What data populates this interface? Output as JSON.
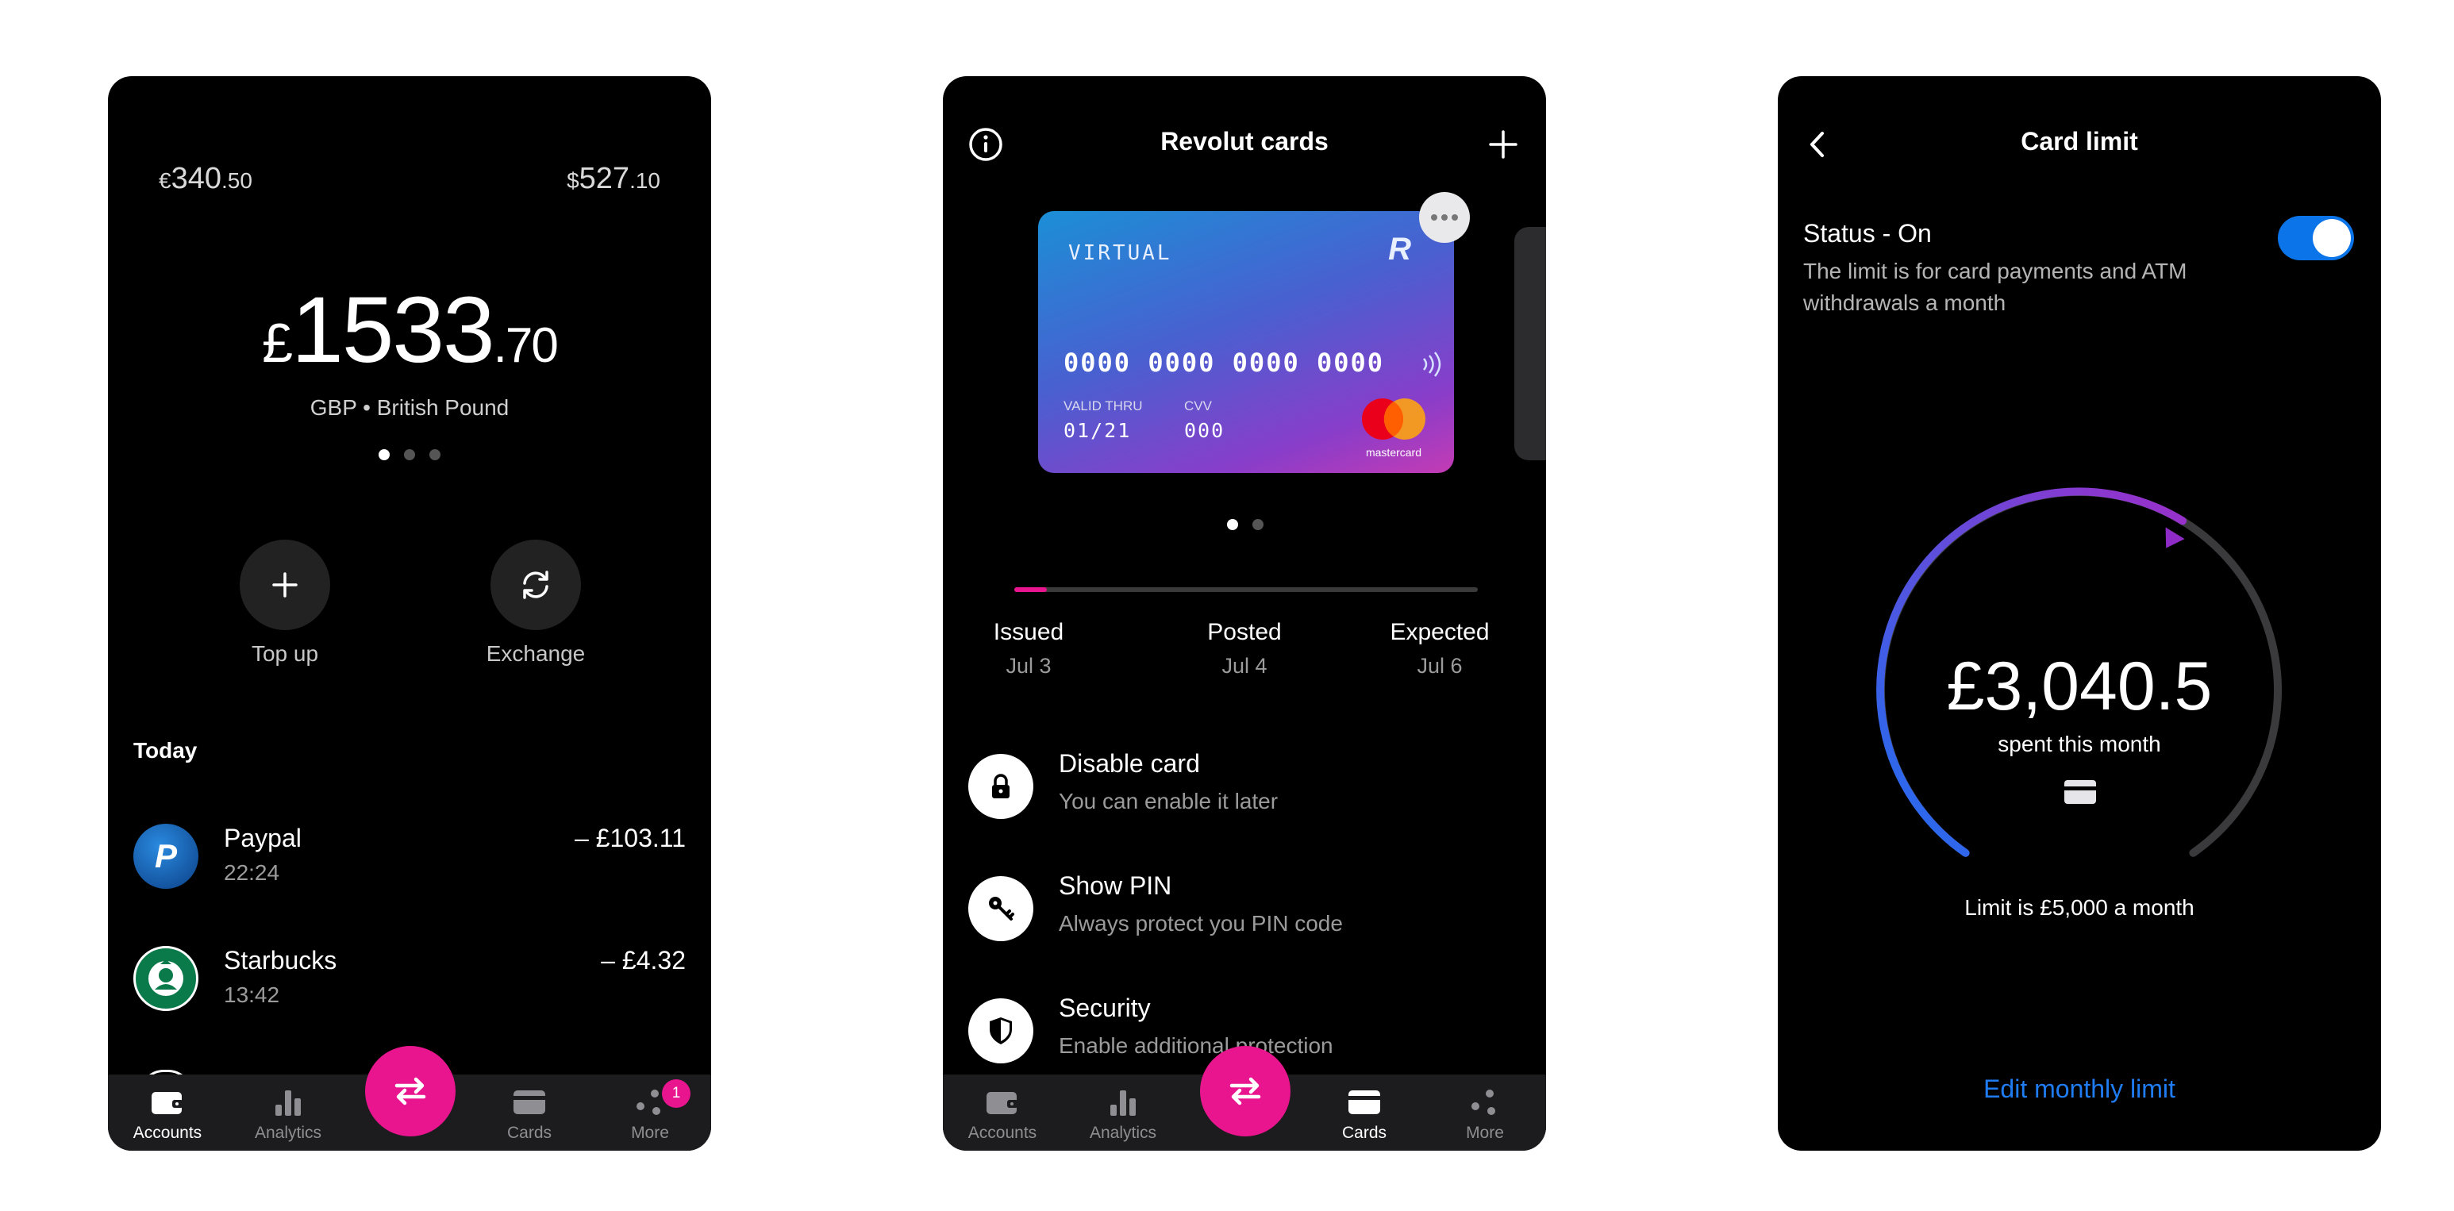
{
  "accounts": {
    "eur_balance": {
      "symbol": "€",
      "whole": "340",
      "decimal": ".50"
    },
    "usd_balance": {
      "symbol": "$",
      "whole": "527",
      "decimal": ".10"
    },
    "main_balance": {
      "symbol": "£",
      "whole": "1533",
      "decimal": ".70"
    },
    "currency_label": "GBP • British Pound",
    "page_dots": {
      "count": 3,
      "active": 0
    },
    "actions": [
      {
        "label": "Top up",
        "icon": "plus-icon"
      },
      {
        "label": "Exchange",
        "icon": "exchange-icon"
      }
    ],
    "section_today": "Today",
    "transactions": [
      {
        "name": "Paypal",
        "time": "22:24",
        "amount": "– £103.11",
        "logo": "paypal-logo-icon"
      },
      {
        "name": "Starbucks",
        "time": "13:42",
        "amount": "– £4.32",
        "logo": "starbucks-logo-icon"
      }
    ]
  },
  "cards": {
    "title": "Revolut cards",
    "info_icon": "info-icon",
    "add_icon": "plus-icon",
    "card": {
      "type": "VIRTUAL",
      "brand_mark": "R",
      "number": "0000 0000 0000 0000",
      "valid_label": "VALID THRU",
      "valid_value": "01/21",
      "cvv_label": "CVV",
      "cvv_value": "000",
      "network": "mastercard"
    },
    "page_dots": {
      "count": 2,
      "active": 0
    },
    "delivery_progress": 0.07,
    "steps": [
      {
        "title": "Issued",
        "date": "Jul 3"
      },
      {
        "title": "Posted",
        "date": "Jul 4"
      },
      {
        "title": "Expected",
        "date": "Jul 6"
      }
    ],
    "options": [
      {
        "title": "Disable card",
        "subtitle": "You can enable it later",
        "icon": "lock-icon"
      },
      {
        "title": "Show PIN",
        "subtitle": "Always protect you PIN code",
        "icon": "key-icon"
      },
      {
        "title": "Security",
        "subtitle": "Enable additional protection",
        "icon": "shield-icon"
      }
    ]
  },
  "tabbar": {
    "items": [
      {
        "label": "Accounts",
        "icon": "wallet-icon"
      },
      {
        "label": "Analytics",
        "icon": "bar-chart-icon"
      },
      {
        "label": "Cards",
        "icon": "card-icon"
      },
      {
        "label": "More",
        "icon": "more-icon"
      }
    ],
    "more_badge": "1",
    "fab_icon": "transfer-arrows-icon"
  },
  "card_limit": {
    "title": "Card limit",
    "back_icon": "chevron-left-icon",
    "status_title": "Status - On",
    "status_description": "The limit is for card payments and ATM withdrawals a month",
    "toggle_on": true,
    "spent_amount": "£3,040.5",
    "spent_label": "spent this month",
    "limit_label": "Limit is £5,000 a month",
    "spent_fraction": 0.608,
    "edit_link": "Edit monthly limit",
    "colors": {
      "gauge_start": "#1e6ff0",
      "gauge_end": "#9b2fc9",
      "accent": "#1f7cf3",
      "pink": "#e8158f"
    }
  }
}
